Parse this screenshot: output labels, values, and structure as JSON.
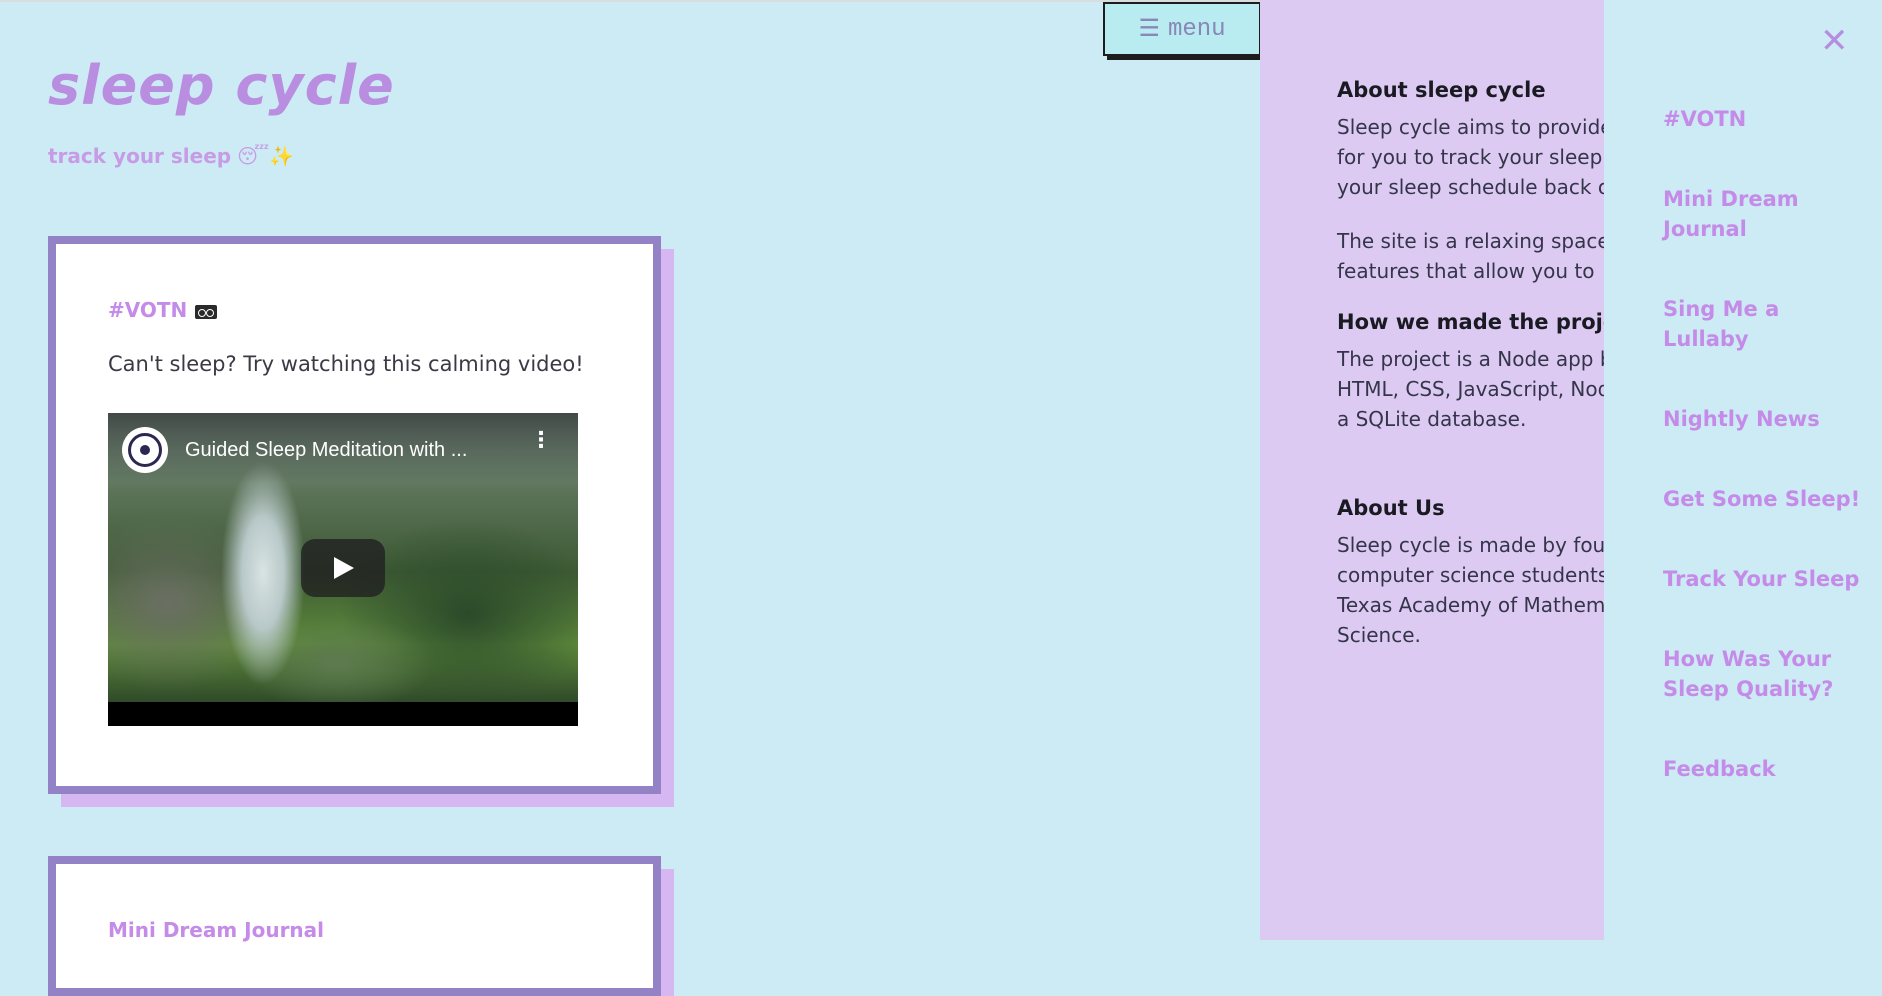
{
  "header": {
    "title": "sleep cycle",
    "tagline": "track your sleep",
    "tagline_emoji": "😴✨"
  },
  "cards": [
    {
      "title": "#VOTN",
      "text": "Can't sleep? Try watching this calming video!",
      "video": {
        "title": "Guided Sleep Meditation with ...",
        "more_icon": "⋮"
      }
    },
    {
      "title": "Mini Dream Journal"
    }
  ],
  "menu_button": {
    "icon": "☰",
    "label": "menu"
  },
  "about": {
    "sections": [
      {
        "heading": "About sleep cycle",
        "paragraphs": [
          "Sleep cycle aims to provide a space for you to track your sleep and get your sleep schedule back on track!",
          "The site is a relaxing space with features that allow you to"
        ]
      },
      {
        "heading": "How we made the project",
        "paragraphs": [
          "The project is a Node app built with HTML, CSS, JavaScript, Node.js and a SQLite database."
        ]
      },
      {
        "heading": "About Us",
        "paragraphs": [
          "Sleep cycle is made by four computer science students at the Texas Academy of Mathematics and Science."
        ]
      }
    ]
  },
  "nav": {
    "close_icon": "✕",
    "items": [
      "#VOTN",
      "Mini Dream Journal",
      "Sing Me a Lullaby",
      "Nightly News",
      "Get Some Sleep!",
      "Track Your Sleep",
      "How Was Your Sleep Quality?",
      "Feedback"
    ]
  },
  "colors": {
    "background": "#cdebf4",
    "accent": "#c48be8",
    "card_border": "#9383c6",
    "card_shadow": "#d7b7f1",
    "about_panel": "#dccaf3",
    "menu_button": "#b8ecf0"
  }
}
